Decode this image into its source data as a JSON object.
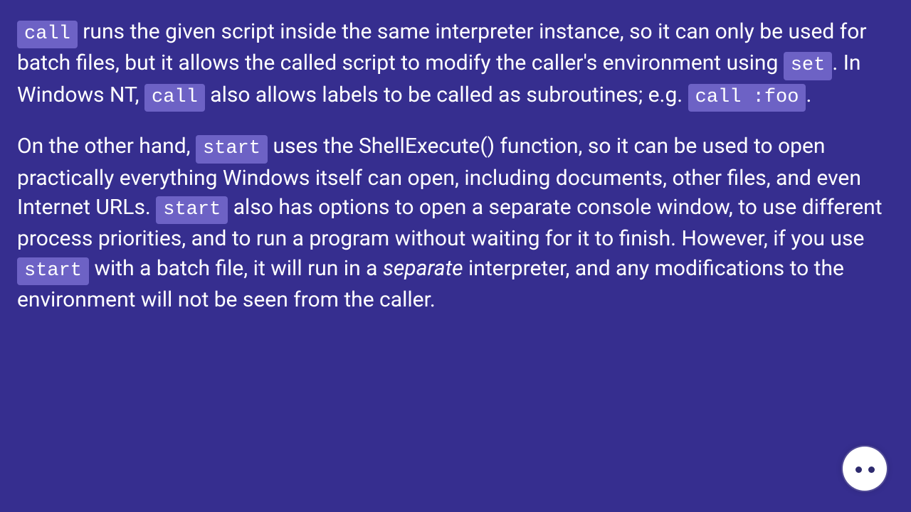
{
  "colors": {
    "bg": "#362E8F",
    "code_bg": "#6D62C5",
    "text": "#ffffff"
  },
  "p1": {
    "c1": "call",
    "t1": " runs the given script inside the same interpreter instance, so it can only be used for batch files, but it allows the called script to modify the caller's environment using ",
    "c2": "set",
    "t2": ". In Windows NT, ",
    "c3": "call",
    "t3": " also allows labels to be called as subroutines; e.g. ",
    "c4": "call :foo",
    "t4": "."
  },
  "p2": {
    "t1": "On the other hand, ",
    "c1": "start",
    "t2": " uses the ShellExecute() function, so it can be used to open practically everything Windows itself can open, including documents, other files, and even Internet URLs. ",
    "c2": "start",
    "t3": " also has options to open a separate console window, to use different process priorities, and to run a program without waiting for it to finish. However, if you use ",
    "c3": "start",
    "t4": " with a batch file, it will run in a ",
    "em": "separate",
    "t5": " interpreter, and any modifications to the environment will not be seen from the caller."
  },
  "avatar": {
    "name": "face-avatar"
  }
}
